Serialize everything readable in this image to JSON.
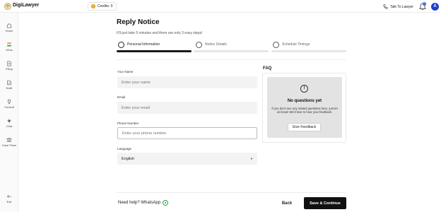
{
  "topbar": {
    "brand": "DigiLawyer",
    "credits": "Credits: 0",
    "talk_label": "Talk To Lawyer",
    "notification_count": "0",
    "avatar_initial": "A"
  },
  "sidebar": {
    "items": [
      {
        "label": "Home",
        "icon": "home-icon"
      },
      {
        "label": "eDos",
        "icon": "flag-icon"
      },
      {
        "label": "Filing",
        "icon": "document-icon"
      },
      {
        "label": "Draft",
        "icon": "draft-icon"
      },
      {
        "label": "Consult",
        "icon": "trophy-icon"
      },
      {
        "label": "Chat",
        "icon": "sparkle-icon"
      },
      {
        "label": "Case Prism",
        "icon": "bank-icon"
      }
    ],
    "exit_label": "Exit"
  },
  "page": {
    "title": "Reply Notice",
    "subtitle": "It'll just take 5 minutes and there are only 3 easy steps!"
  },
  "steps": [
    {
      "label": "Personal Information",
      "active": true
    },
    {
      "label": "Notice Details",
      "active": false
    },
    {
      "label": "Schedule Timings",
      "active": false
    }
  ],
  "form": {
    "name_label": "Your Name",
    "name_placeholder": "Enter your name",
    "email_label": "Email",
    "email_placeholder": "Enter your email",
    "phone_label": "Phone Number",
    "phone_placeholder": "Enter your phone number",
    "language_label": "Language",
    "language_value": "English"
  },
  "faq": {
    "title": "FAQ",
    "empty_title": "No questions yet",
    "empty_body": "If you don't see any related questions here, just let us know! We'd love to hear your feedback.",
    "feedback_button": "Give Feedback"
  },
  "footer": {
    "help_text": "Need help? WhatsApp",
    "back_label": "Back",
    "continue_label": "Save & Continue"
  },
  "colors": {
    "primary_button": "#111111",
    "avatar": "#1e40c8",
    "coin": "#f0b82a",
    "whatsapp": "#25a244"
  }
}
